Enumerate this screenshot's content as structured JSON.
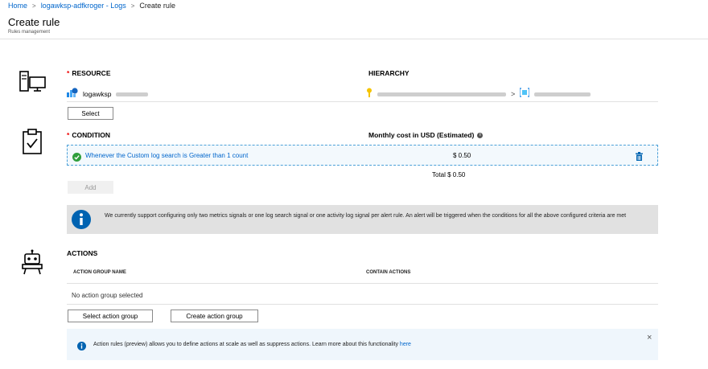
{
  "breadcrumb": {
    "home": "Home",
    "workspace": "logawksp-adfkroger - Logs",
    "current": "Create rule"
  },
  "page": {
    "title": "Create rule",
    "subtitle": "Rules management"
  },
  "resource": {
    "label": "RESOURCE",
    "hierarchy_label": "HIERARCHY",
    "name": "logawksp",
    "select_button": "Select"
  },
  "condition": {
    "label": "CONDITION",
    "cost_label": "Monthly cost in USD (Estimated)",
    "item_text": "Whenever the Custom log search is Greater than 1 count",
    "item_cost": "$ 0.50",
    "total": "Total $ 0.50",
    "add_button": "Add"
  },
  "info": {
    "message": "We currently support configuring only two metrics signals or one log search signal or one activity log signal per alert rule. An alert will be triggered when the conditions for all the above configured criteria are met"
  },
  "actions": {
    "label": "ACTIONS",
    "col_group_name": "ACTION GROUP NAME",
    "col_contain_actions": "CONTAIN ACTIONS",
    "empty_text": "No action group selected",
    "select_button": "Select action group",
    "create_button": "Create action group"
  },
  "action_rules_note": {
    "text": "Action rules (preview) allows you to define actions at scale as well as suppress actions. Learn more about this functionality",
    "link": "here",
    "close": "×"
  },
  "colors": {
    "link": "#0066cc",
    "required": "#ee0000",
    "success": "#2e9e3c",
    "info": "#0063b1"
  }
}
